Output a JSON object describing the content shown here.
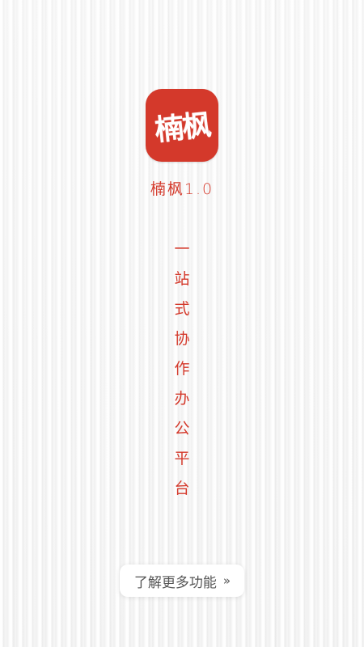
{
  "app": {
    "icon_text": "楠枫",
    "name": "楠枫1.0",
    "brand_color": "#d4392b"
  },
  "slogan": {
    "chars": [
      "一",
      "站",
      "式",
      "协",
      "作",
      "办",
      "公",
      "平",
      "台"
    ]
  },
  "more_button": {
    "label": "了解更多功能",
    "icon": "double-chevron-right-icon",
    "icon_glyph": "»"
  }
}
